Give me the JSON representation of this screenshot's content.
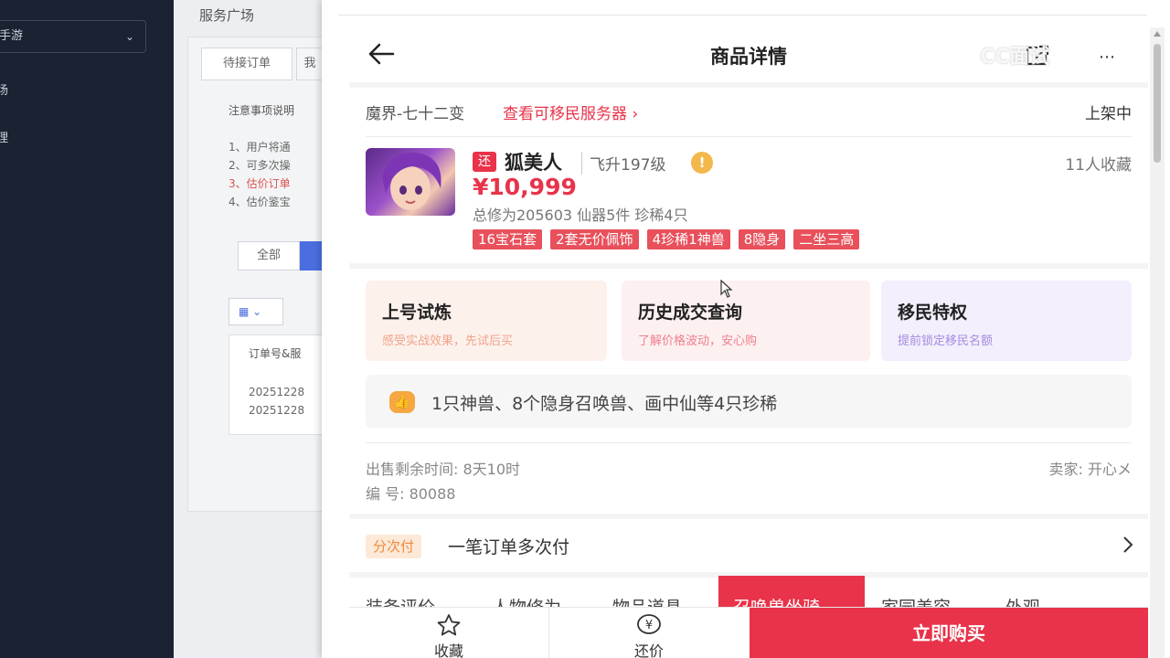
{
  "sidebar": {
    "select_label": "手游",
    "items": [
      {
        "label": "场"
      },
      {
        "label": "理"
      }
    ]
  },
  "background": {
    "page_title": "服务广场",
    "tabs": [
      {
        "label": "待接订单"
      },
      {
        "label": "我"
      }
    ],
    "notice_title": "注意事项说明",
    "notice_lines": [
      "1、用户将通",
      "2、可多次操",
      "3、估价订单",
      "4、估价鉴宝"
    ],
    "filter_all": "全部",
    "table_header": "订单号&服",
    "table_rows": [
      "20251228",
      "20251228"
    ]
  },
  "detail": {
    "nav_title": "商品详情",
    "watermark": "CC面试",
    "server_name": "魔界-七十二变",
    "server_link": "查看可移民服务器",
    "status": "上架中",
    "return_tag": "还",
    "character_name": "狐美人",
    "level": "飞升197级",
    "fav_count": "11人收藏",
    "price": "¥10,999",
    "stats": "总修为205603  仙器5件  珍稀4只",
    "tags": [
      "16宝石套",
      "2套无价佩饰",
      "4珍稀1神兽",
      "8隐身",
      "二坐三高"
    ],
    "cards": [
      {
        "title": "上号试炼",
        "subtitle": "感受实战效果，先试后买",
        "sub_color": "#f0a48a"
      },
      {
        "title": "历史成交查询",
        "subtitle": "了解价格波动，安心购",
        "sub_color": "#ef7f8c"
      },
      {
        "title": "移民特权",
        "subtitle": "提前锁定移民名额",
        "sub_color": "#a58be0"
      }
    ],
    "highlight": "1只神兽、8个隐身召唤兽、画中仙等4只珍稀",
    "remaining_time": "出售剩余时间: 8天10时",
    "seller": "卖家: 开心メ",
    "code": "编 号: 80088",
    "installment_badge": "分次付",
    "installment_text": "一笔订单多次付",
    "tabs": [
      {
        "label": "装备评价"
      },
      {
        "label": "人物修为"
      },
      {
        "label": "物品道具"
      },
      {
        "label": "召唤兽坐骑",
        "active": true
      },
      {
        "label": "家园美容"
      },
      {
        "label": "外观"
      }
    ]
  },
  "bottom_bar": {
    "favorite_label": "收藏",
    "bargain_label": "还价",
    "buy_label": "立即购买"
  },
  "colors": {
    "accent": "#e8334a",
    "sidebar_bg": "#1b2232"
  }
}
